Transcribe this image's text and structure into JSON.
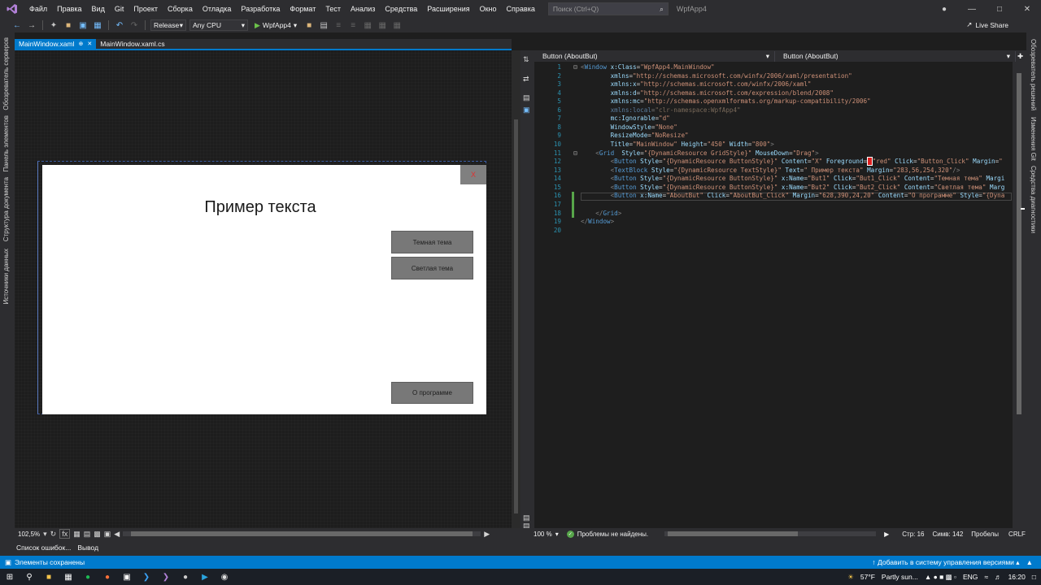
{
  "menu": {
    "items": [
      "Файл",
      "Правка",
      "Вид",
      "Git",
      "Проект",
      "Сборка",
      "Отладка",
      "Разработка",
      "Формат",
      "Тест",
      "Анализ",
      "Средства",
      "Расширения",
      "Окно",
      "Справка"
    ],
    "search_placeholder": "Поиск (Ctrl+Q)",
    "app_title": "WpfApp4"
  },
  "toolbar": {
    "config": "Release",
    "platform": "Any CPU",
    "run_target": "WpfApp4",
    "live_share": "Live Share"
  },
  "left_bar": {
    "items": [
      "Обозреватель серверов",
      "Панель элементов",
      "Структура документа",
      "Источники данных"
    ]
  },
  "right_bar": {
    "items": [
      "Обозреватель решений",
      "Изменения Git",
      "Средства диагностики"
    ]
  },
  "design_tabs": {
    "active": "MainWindow.xaml",
    "other": "MainWindow.xaml.cs"
  },
  "preview": {
    "title_text": "Пример текста",
    "close_label": "X",
    "btn_dark": "Темная тема",
    "btn_light": "Светлая тема",
    "btn_about": "О программе"
  },
  "designer_bottom": {
    "zoom": "102,5%",
    "fx": "fx"
  },
  "code_header": {
    "left": "Button (AboutBut)",
    "right": "Button (AboutBut)"
  },
  "code": {
    "line_numbers": [
      "1",
      "2",
      "3",
      "4",
      "5",
      "6",
      "7",
      "8",
      "9",
      "10",
      "11",
      "12",
      "13",
      "14",
      "15",
      "16",
      "17",
      "18",
      "19",
      "20"
    ]
  },
  "editor_bottom": {
    "zoom": "100 %",
    "status": "Проблемы не найдены.",
    "line": "Стр: 16",
    "col": "Симв: 142",
    "spaces": "Пробелы",
    "eol": "CRLF"
  },
  "output_tabs": [
    "Список ошибок...",
    "Вывод"
  ],
  "statusbar": {
    "left": "Элементы сохранены",
    "vcs": "Добавить в систему управления версиями"
  },
  "taskbar": {
    "weather": "57°F",
    "weather_text": "Partly sun...",
    "lang": "ENG",
    "time": "16:20"
  },
  "colors": {
    "accent": "#007acc",
    "menu_bg": "#2d2d30",
    "editor_bg": "#1e1e1e"
  }
}
